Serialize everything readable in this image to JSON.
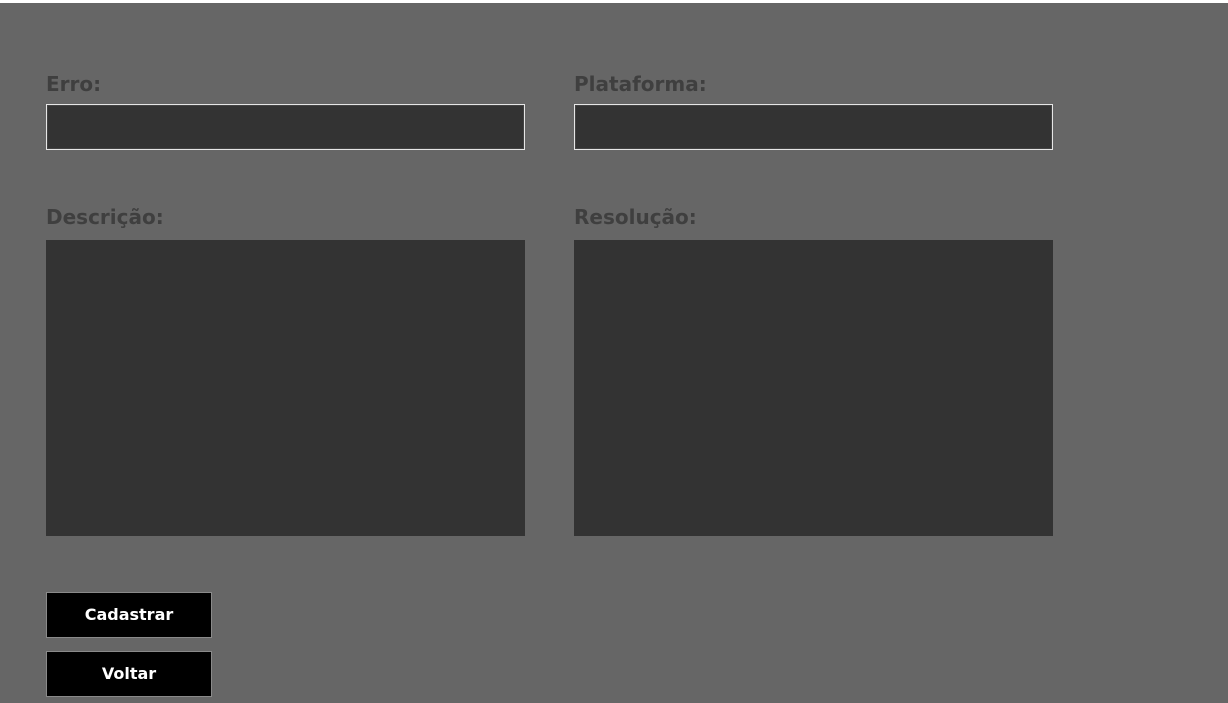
{
  "form": {
    "erro": {
      "label": "Erro:",
      "value": ""
    },
    "plataforma": {
      "label": "Plataforma:",
      "value": ""
    },
    "descricao": {
      "label": "Descrição:",
      "value": ""
    },
    "resolucao": {
      "label": "Resolução:",
      "value": ""
    }
  },
  "buttons": {
    "cadastrar_label": "Cadastrar",
    "voltar_label": "Voltar"
  },
  "colors": {
    "background": "#666666",
    "field": "#333333",
    "label": "#3f3f3f",
    "button": "#000000",
    "button_text": "#ffffff"
  }
}
